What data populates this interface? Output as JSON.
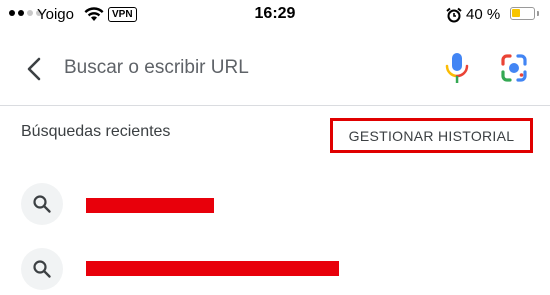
{
  "status_bar": {
    "carrier": "Yoigo",
    "vpn": "VPN",
    "time": "16:29",
    "battery": "40 %",
    "battery_level": 0.4
  },
  "search": {
    "placeholder": "Buscar o escribir URL",
    "icons": [
      "back-arrow-icon",
      "microphone-icon",
      "google-lens-icon"
    ]
  },
  "recent": {
    "title": "Búsquedas recientes",
    "manage_label": "GESTIONAR HISTORIAL",
    "items": [
      {
        "icon": "search-icon",
        "redacted": true
      },
      {
        "icon": "search-icon",
        "redacted": true
      }
    ]
  },
  "colors": {
    "accent_red": "#e00000",
    "mic_blue": "#4285f4",
    "mic_red": "#ea4335",
    "mic_yellow": "#fbbc04",
    "mic_green": "#34a853"
  }
}
